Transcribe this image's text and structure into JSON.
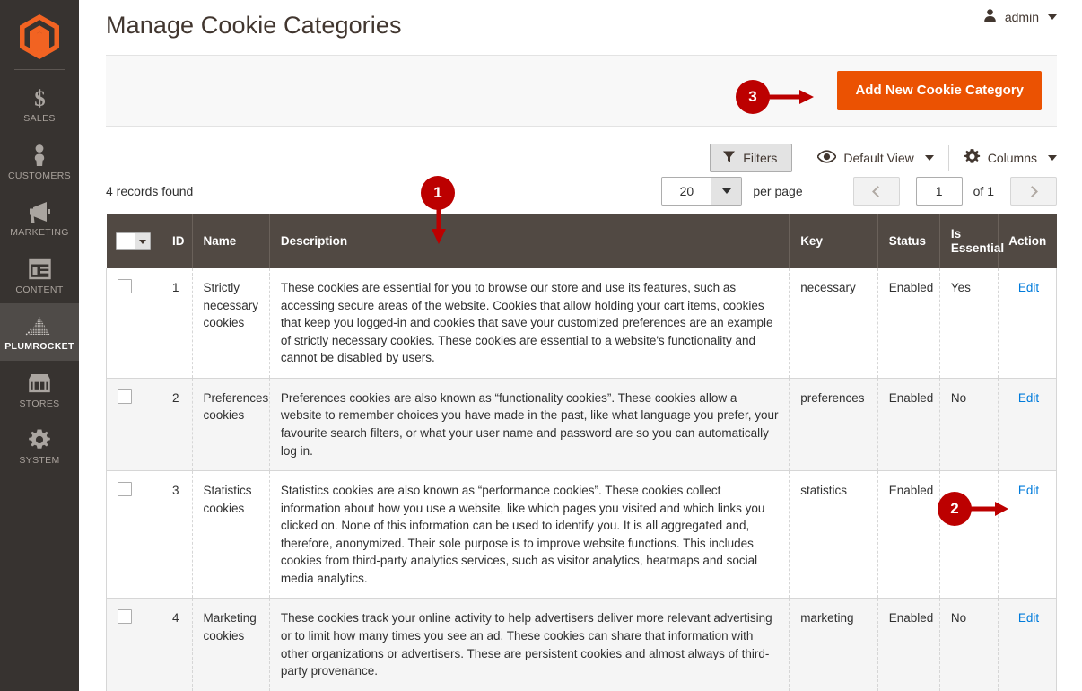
{
  "sidebar": {
    "logo_name": "magento-logo-icon",
    "items": [
      {
        "label": "SALES",
        "icon": "dollar-icon",
        "active": false
      },
      {
        "label": "CUSTOMERS",
        "icon": "person-icon",
        "active": false
      },
      {
        "label": "MARKETING",
        "icon": "megaphone-icon",
        "active": false
      },
      {
        "label": "CONTENT",
        "icon": "layout-icon",
        "active": false
      },
      {
        "label": "PLUMROCKET",
        "icon": "plumrocket-icon",
        "active": true
      },
      {
        "label": "STORES",
        "icon": "store-icon",
        "active": false
      },
      {
        "label": "SYSTEM",
        "icon": "gear-icon",
        "active": false
      }
    ]
  },
  "header": {
    "title": "Manage Cookie Categories",
    "admin_label": "admin"
  },
  "page_actions": {
    "add_button_label": "Add New Cookie Category"
  },
  "toolbar": {
    "filters_label": "Filters",
    "view_label": "Default View",
    "columns_label": "Columns"
  },
  "grid_controls": {
    "records_found": "4 records found",
    "per_page_value": "20",
    "per_page_label": "per page",
    "page_value": "1",
    "of_label": "of 1"
  },
  "table": {
    "columns": [
      "",
      "ID",
      "Name",
      "Description",
      "Key",
      "Status",
      "Is Essential",
      "Action"
    ],
    "rows": [
      {
        "id": "1",
        "name": "Strictly necessary cookies",
        "description": "These cookies are essential for you to browse our store and use its features, such as accessing secure areas of the website. Cookies that allow holding your cart items, cookies that keep you logged-in and cookies that save your customized preferences are an example of strictly necessary cookies. These cookies are essential to a website's functionality and cannot be disabled by users.",
        "key": "necessary",
        "status": "Enabled",
        "is_essential": "Yes",
        "action": "Edit"
      },
      {
        "id": "2",
        "name": "Preferences cookies",
        "description": "Preferences cookies are also known as “functionality cookies”. These cookies allow a website to remember choices you have made in the past, like what language you prefer, your favourite search filters, or what your user name and password are so you can automatically log in.",
        "key": "preferences",
        "status": "Enabled",
        "is_essential": "No",
        "action": "Edit"
      },
      {
        "id": "3",
        "name": "Statistics cookies",
        "description": "Statistics cookies are also known as “performance cookies”. These cookies collect information about how you use a website, like which pages you visited and which links you clicked on. None of this information can be used to identify you. It is all aggregated and, therefore, anonymized. Their sole purpose is to improve website functions. This includes cookies from third-party analytics services, such as visitor analytics, heatmaps and social media analytics.",
        "key": "statistics",
        "status": "Enabled",
        "is_essential": "",
        "action": "Edit"
      },
      {
        "id": "4",
        "name": "Marketing cookies",
        "description": "These cookies track your online activity to help advertisers deliver more relevant advertising or to limit how many times you see an ad. These cookies can share that information with other organizations or advertisers. These are persistent cookies and almost always of third-party provenance.",
        "key": "marketing",
        "status": "Enabled",
        "is_essential": "No",
        "action": "Edit"
      }
    ]
  },
  "callouts": [
    {
      "number": "1",
      "direction": "down"
    },
    {
      "number": "2",
      "direction": "right"
    },
    {
      "number": "3",
      "direction": "right"
    }
  ],
  "colors": {
    "accent_orange": "#eb5202",
    "callout_red": "#bc0000",
    "sidebar_bg": "#373330",
    "table_header_bg": "#514943",
    "link_blue": "#007bdb"
  }
}
